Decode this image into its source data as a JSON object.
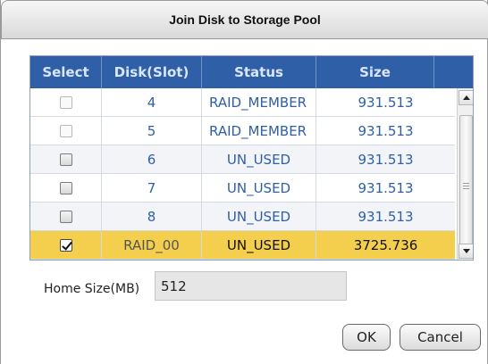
{
  "dialog": {
    "title": "Join Disk to Storage Pool"
  },
  "table": {
    "columns": [
      "Select",
      "Disk(Slot)",
      "Status",
      "Size"
    ],
    "rows": [
      {
        "checkbox": "disabled",
        "disk": "4",
        "status": "RAID_MEMBER",
        "size": "931.513"
      },
      {
        "checkbox": "disabled",
        "disk": "5",
        "status": "RAID_MEMBER",
        "size": "931.513"
      },
      {
        "checkbox": "unchecked",
        "disk": "6",
        "status": "UN_USED",
        "size": "931.513"
      },
      {
        "checkbox": "unchecked",
        "disk": "7",
        "status": "UN_USED",
        "size": "931.513"
      },
      {
        "checkbox": "unchecked",
        "disk": "8",
        "status": "UN_USED",
        "size": "931.513"
      },
      {
        "checkbox": "checked",
        "disk": "RAID_00",
        "status": "UN_USED",
        "size": "3725.736"
      }
    ]
  },
  "home_size": {
    "label": "Home Size(MB)",
    "value": "512"
  },
  "buttons": {
    "ok": "OK",
    "cancel": "Cancel"
  },
  "colors": {
    "header_bg": "#2f5fa6",
    "selected_row": "#f3cf4d",
    "text_blue": "#2f5fa6"
  },
  "icons": {
    "scroll_up": "triangle-up-icon",
    "scroll_down": "triangle-down-icon",
    "checkmark": "checkmark-icon"
  }
}
